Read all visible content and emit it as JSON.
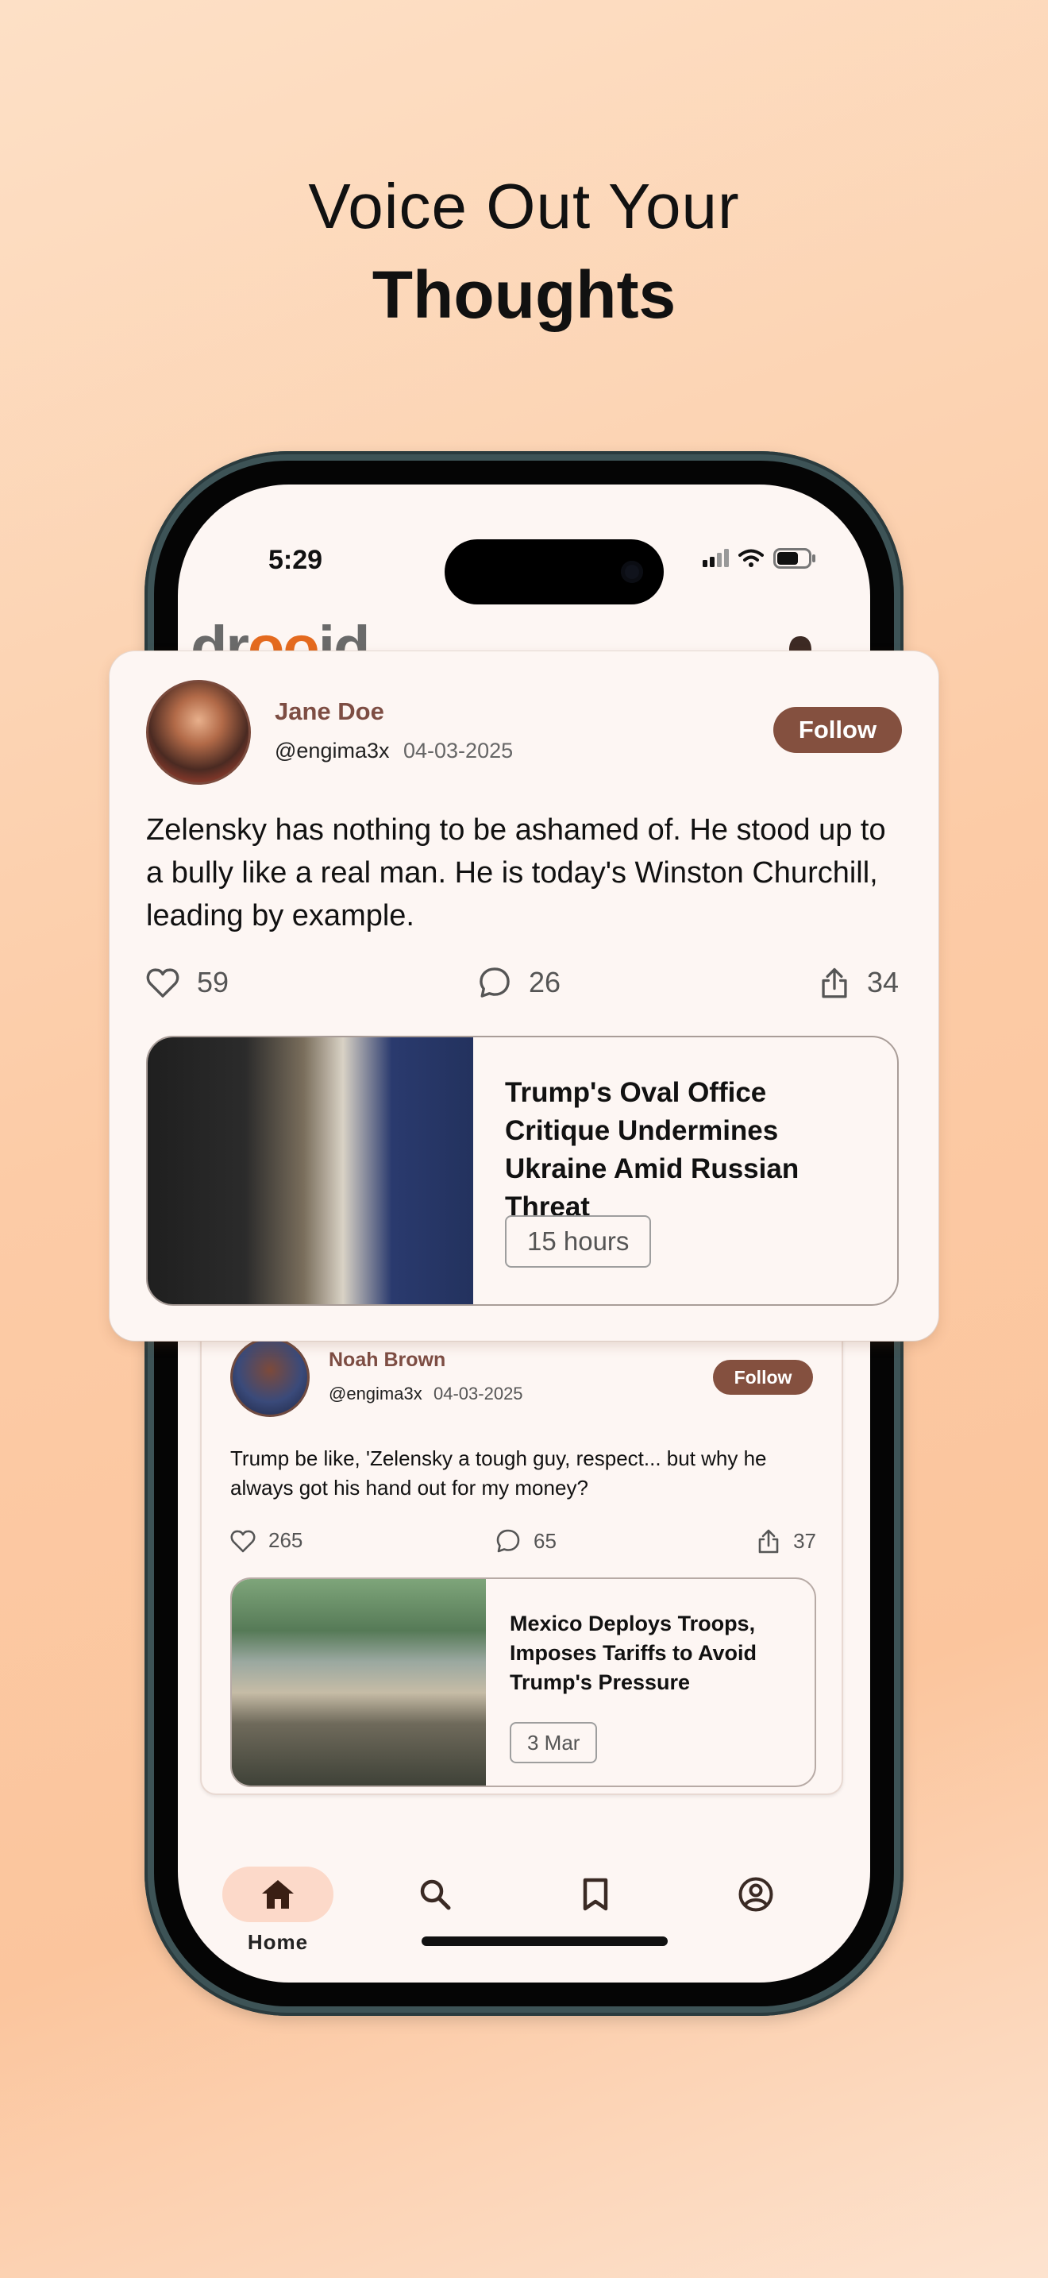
{
  "headline": {
    "line1": "Voice Out Your",
    "line2": "Thoughts"
  },
  "status_bar": {
    "time": "5:29"
  },
  "app": {
    "logo_prefix": "dr",
    "logo_mid": "oo",
    "logo_suffix": "id"
  },
  "posts": [
    {
      "name": "Jane Doe",
      "handle": "@engima3x",
      "date": "04-03-2025",
      "follow_label": "Follow",
      "text": "Zelensky has nothing to be ashamed of. He stood up to a bully like a real man. He is today's Winston Churchill, leading by example.",
      "likes": "59",
      "comments": "26",
      "shares": "34",
      "news": {
        "title": "Trump's Oval Office Critique Undermines Ukraine Amid Russian Threat",
        "time": "15 hours"
      }
    },
    {
      "name": "Noah Brown",
      "handle": "@engima3x",
      "date": "04-03-2025",
      "follow_label": "Follow",
      "text": "Trump be like, 'Zelensky a tough guy, respect... but why he always got his hand out for my money?",
      "likes": "265",
      "comments": "65",
      "shares": "37",
      "news": {
        "title": "Mexico Deploys Troops, Imposes Tariffs to Avoid Trump's Pressure",
        "time": "3 Mar"
      }
    }
  ],
  "nav": {
    "home_label": "Home",
    "active": "home",
    "items": [
      "home-icon",
      "search-icon",
      "bookmark-icon",
      "profile-icon"
    ]
  },
  "colors": {
    "accent": "#84503f",
    "name": "#7d4d43",
    "nav_active_bg": "#fcd9c9",
    "background": "#fccba6"
  }
}
